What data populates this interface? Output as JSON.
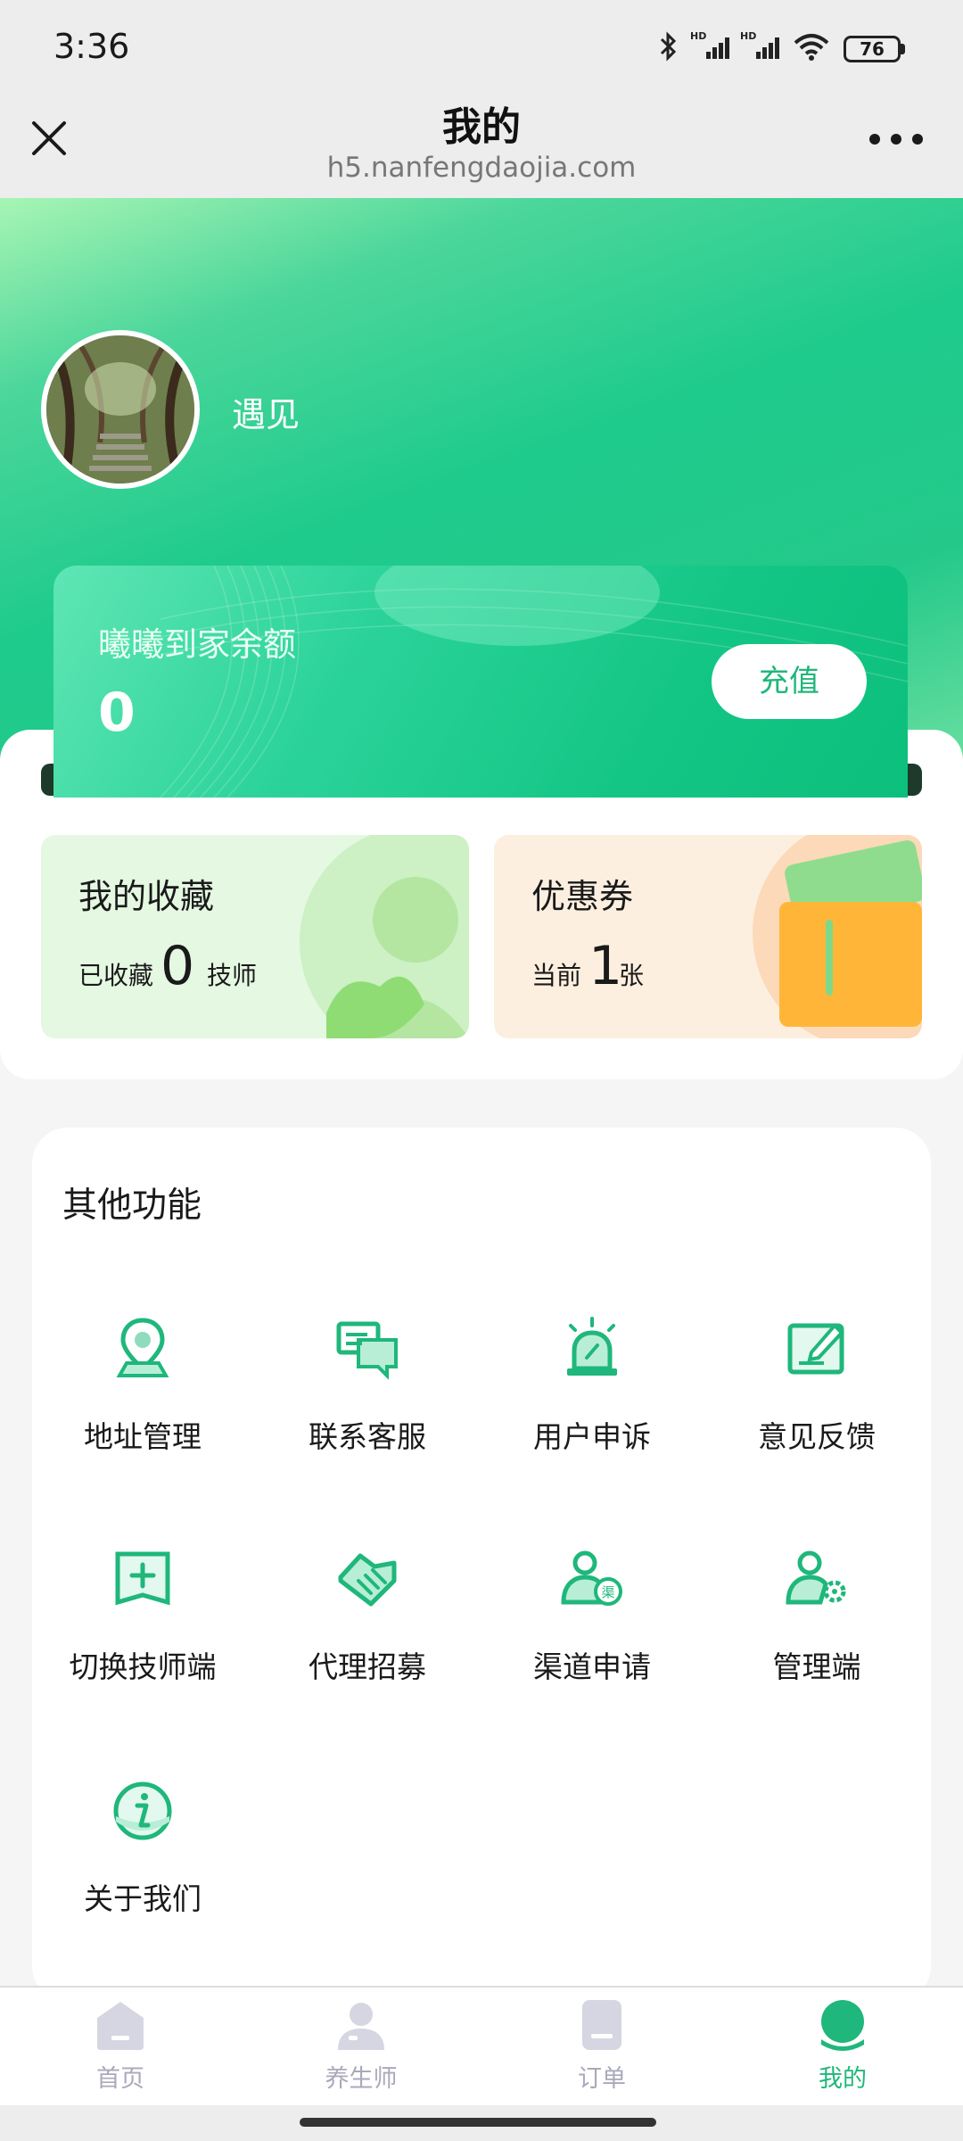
{
  "status_bar": {
    "time": "3:36",
    "battery": "76"
  },
  "title_bar": {
    "title": "我的",
    "url": "h5.nanfengdaojia.com"
  },
  "profile": {
    "name": "遇见"
  },
  "balance": {
    "label": "曦曦到家余额",
    "value": "0",
    "recharge": "充值"
  },
  "favorites": {
    "title": "我的收藏",
    "prefix": "已收藏",
    "count": "0",
    "suffix": "技师"
  },
  "coupons": {
    "title": "优惠券",
    "prefix": "当前",
    "count": "1",
    "suffix": "张"
  },
  "functions": {
    "title": "其他功能",
    "items": [
      {
        "label": "地址管理",
        "icon": "location-pin-icon"
      },
      {
        "label": "联系客服",
        "icon": "chat-bubbles-icon"
      },
      {
        "label": "用户申诉",
        "icon": "alarm-siren-icon"
      },
      {
        "label": "意见反馈",
        "icon": "edit-note-icon"
      },
      {
        "label": "切换技师端",
        "icon": "switch-plus-icon"
      },
      {
        "label": "代理招募",
        "icon": "handshake-icon"
      },
      {
        "label": "渠道申请",
        "icon": "channel-user-icon"
      },
      {
        "label": "管理端",
        "icon": "user-settings-icon"
      },
      {
        "label": "关于我们",
        "icon": "info-icon"
      }
    ]
  },
  "tabs": [
    {
      "label": "首页",
      "icon": "home-icon",
      "active": false
    },
    {
      "label": "养生师",
      "icon": "therapist-icon",
      "active": false
    },
    {
      "label": "订单",
      "icon": "order-icon",
      "active": false
    },
    {
      "label": "我的",
      "icon": "profile-icon",
      "active": true
    }
  ],
  "colors": {
    "accent": "#1fb77b",
    "tab_inactive": "#a9a9bb"
  }
}
